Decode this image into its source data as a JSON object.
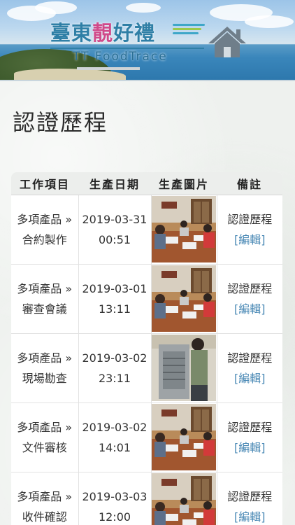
{
  "header": {
    "logo_title_part1": "臺東",
    "logo_title_highlight": "靚",
    "logo_title_part2": "好禮",
    "logo_subtitle": "TT FoodTrace",
    "home_icon": "home-icon"
  },
  "page": {
    "title": "認證歷程"
  },
  "table": {
    "columns": [
      "工作項目",
      "生產日期",
      "生產圖片",
      "備註"
    ],
    "rows": [
      {
        "item_line1": "多項產品 »",
        "item_line2": "合約製作",
        "date": "2019-03-31",
        "time": "00:51",
        "photo": "meeting-photo",
        "note": "認證歷程",
        "edit": "[編輯]"
      },
      {
        "item_line1": "多項產品 »",
        "item_line2": "審查會議",
        "date": "2019-03-01",
        "time": "13:11",
        "photo": "meeting-photo",
        "note": "認證歷程",
        "edit": "[編輯]"
      },
      {
        "item_line1": "多項產品 »",
        "item_line2": "現場勘查",
        "date": "2019-03-02",
        "time": "23:11",
        "photo": "equipment-photo",
        "note": "認證歷程",
        "edit": "[編輯]"
      },
      {
        "item_line1": "多項產品 »",
        "item_line2": "文件審核",
        "date": "2019-03-02",
        "time": "14:01",
        "photo": "meeting-photo",
        "note": "認證歷程",
        "edit": "[編輯]"
      },
      {
        "item_line1": "多項產品 »",
        "item_line2": "收件確認",
        "date": "2019-03-03",
        "time": "12:00",
        "photo": "meeting-photo",
        "note": "認證歷程",
        "edit": "[編輯]"
      }
    ]
  },
  "colors": {
    "accent_blue": "#2f7fa6",
    "highlight_pink": "#d04a8a",
    "link_blue": "#4a89b5"
  }
}
